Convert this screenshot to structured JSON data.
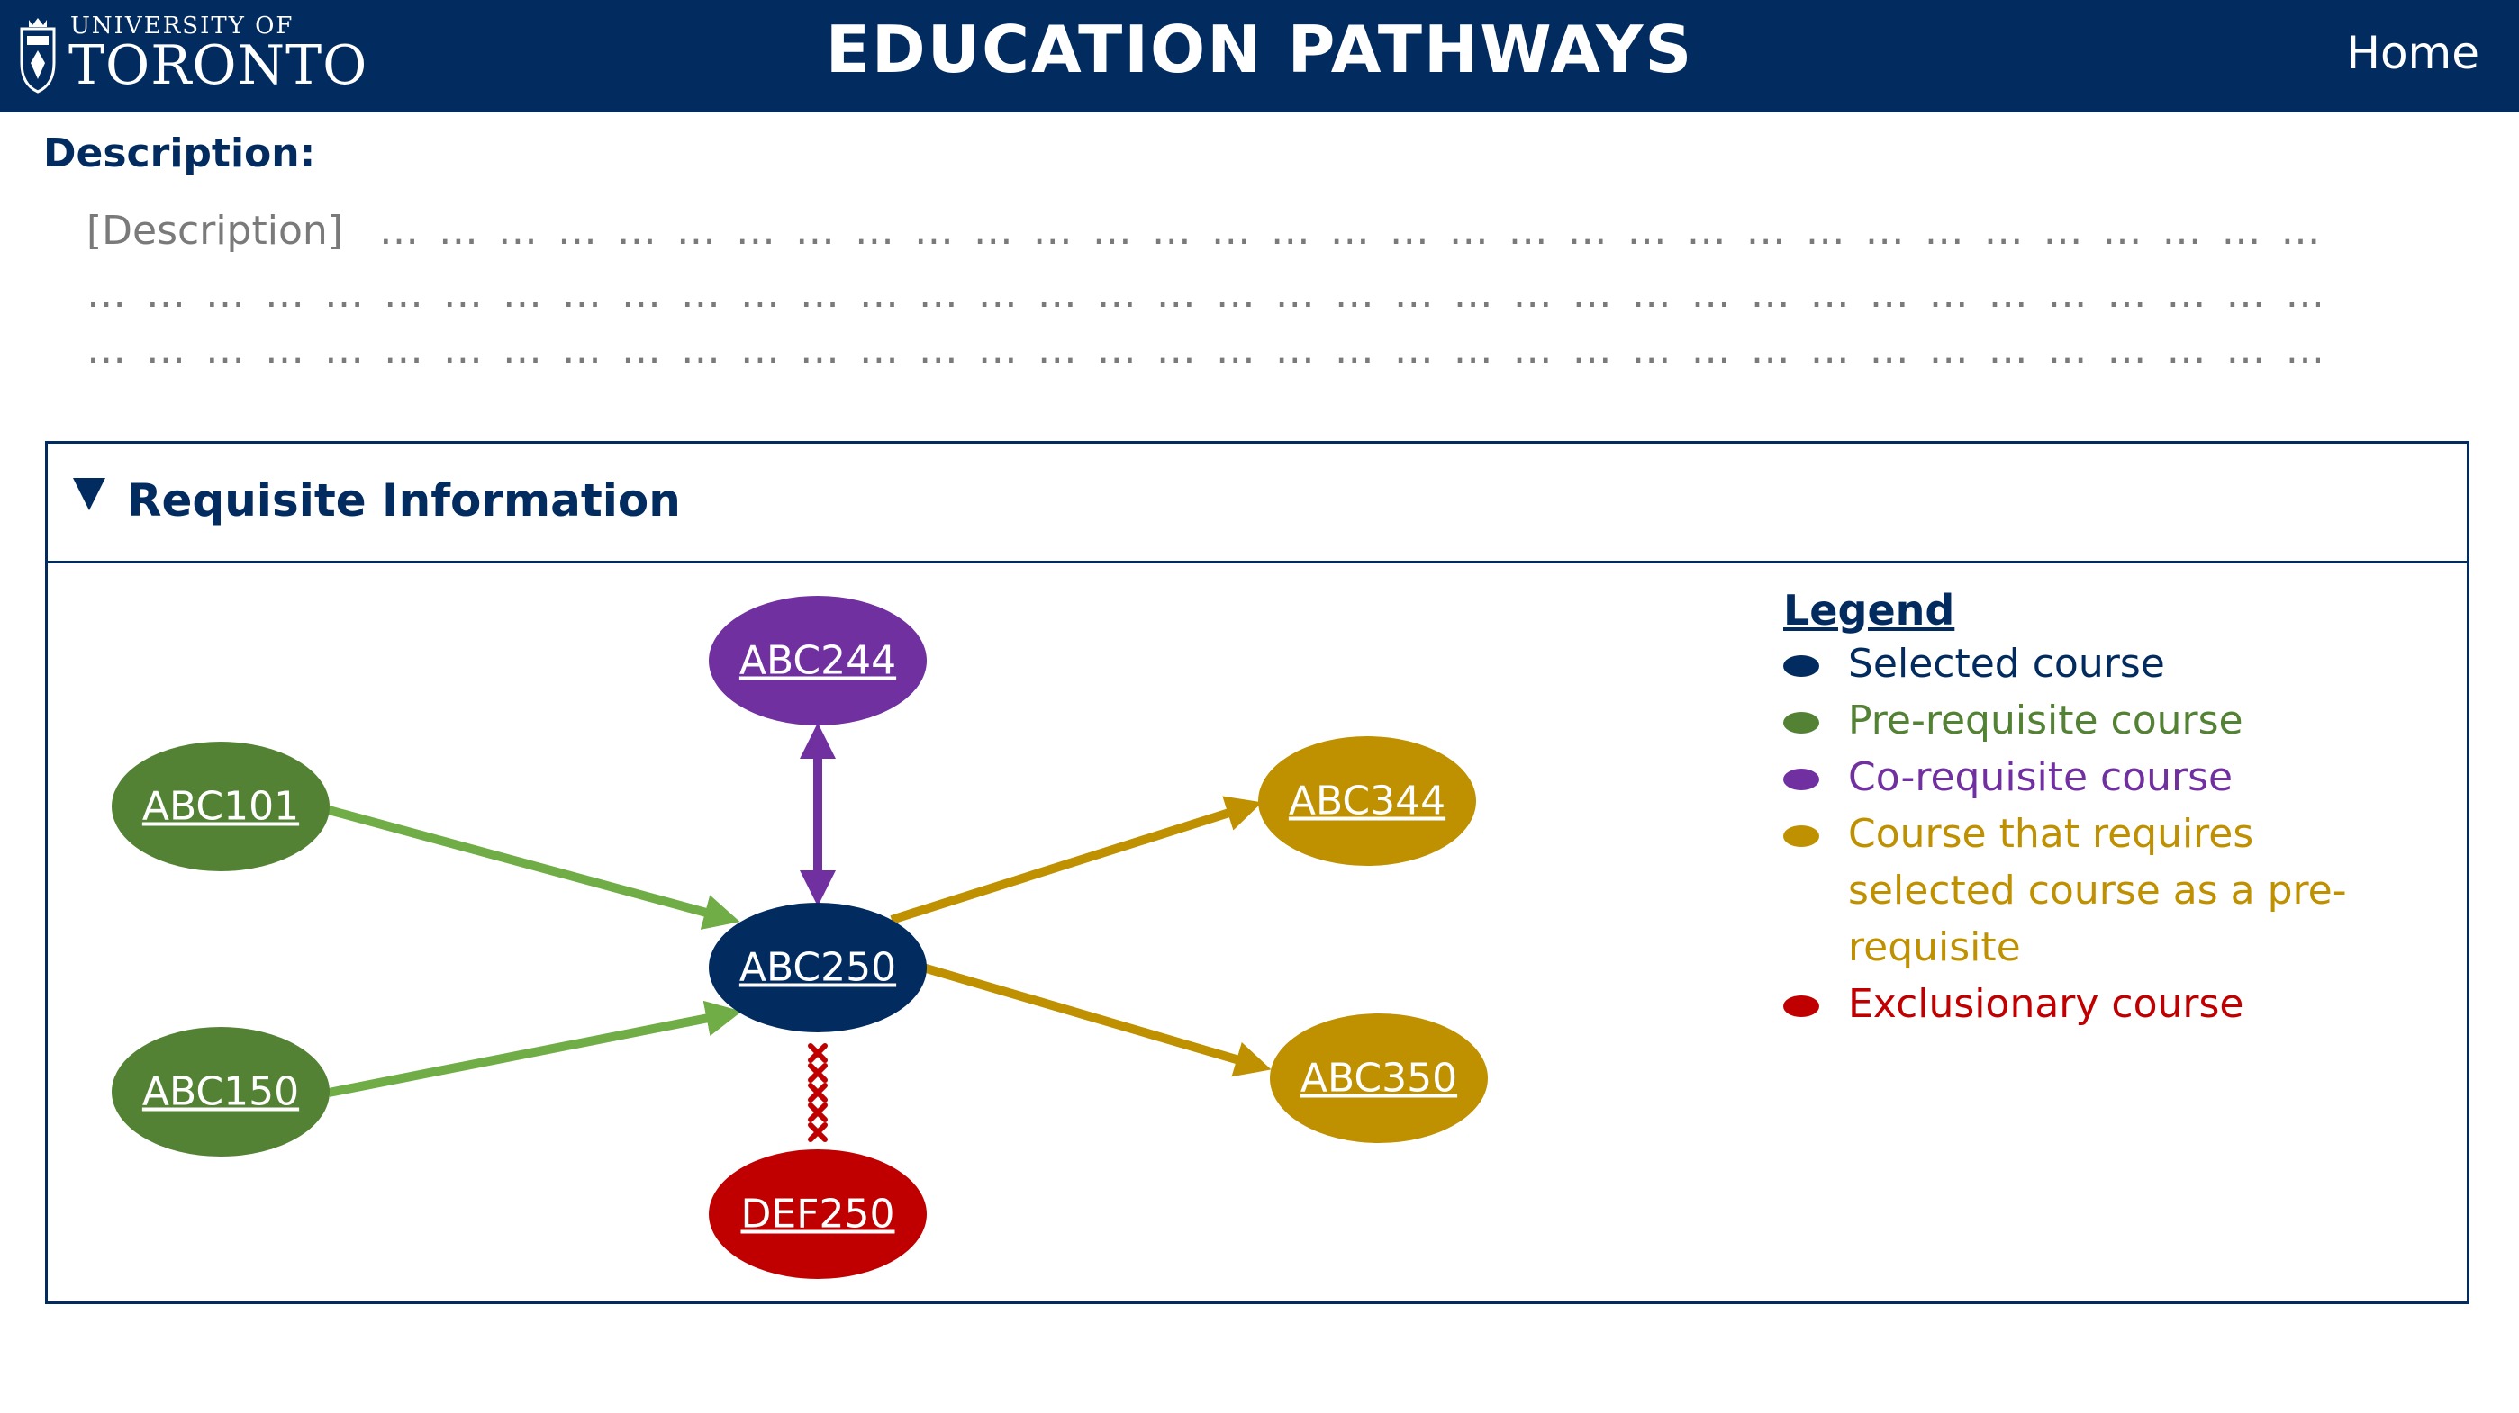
{
  "header": {
    "university_top": "UNIVERSITY OF",
    "university_name": "TORONTO",
    "title": "EDUCATION PATHWAYS",
    "home_link": "Home"
  },
  "description": {
    "heading": "Description:",
    "placeholder": "[Description]",
    "line1_dots": "… … … … … … … … … … … … … … … … … … … … … … … … … … … … … … … … … … … … … … … … … … … … … … … … …",
    "line2_dots": "… … … … … … … … … … … … … … … … … … … … … … … … … … … … … … … … … … … … … … … … … … … … … … … … … … … … … .",
    "line3_dots": "… … … … … … … … … … … … … … … … … … … … … … … … … … … … … … … … … … … … … … … … … … … … … … … … … … … … … ."
  },
  "requisites": {
    "section_title": "Requisite Information",
    "nodes": [
      {
        "code": "ABC250",
        "role": "selected",
        "color": "#022b60"
      },
      {
        "code": "ABC244",
        "role": "co-requisite",
        "color": "#7030a0"
      },
      {
        "code": "ABC101",
        "role": "pre-requisite",
        "color": "#548235"
      },
      {
        "code": "ABC150",
        "role": "pre-requisite",
        "color": "#548235"
      },
      {
        "code": "ABC344",
        "role": "requires-selected",
        "color": "#bf9000"
      },
      {
        "code": "ABC350",
        "role": "requires-selected",
        "color": "#bf9000"
      },
      {
        "code": "DEF250",
        "role": "exclusionary",
        "color": "#c00000"
      }
    ],
    "edge_colors": {
      "pre-requisite": "#70ad47",
      "co-requisite": "#7030a0",
      "requires-selected": "#bf9000",
      "exclusionary": "#c00000"
    }
  },
  "legend": {
    "title": "Legend",
    "items": [
      {
        "label": "Selected course",
        "color": "#022b60"
      },
      {
        "label": "Pre-requisite course",
        "color": "#548235"
      },
      {
        "label": "Co-requisite course",
        "color": "#7030a0"
      },
      {
        "label": "Course that requires selected course as a pre-requisite",
        "color": "#bf9000"
      },
      {
        "label": "Exclusionary course",
        "color": "#c00000"
      }
    ]
  }
}
